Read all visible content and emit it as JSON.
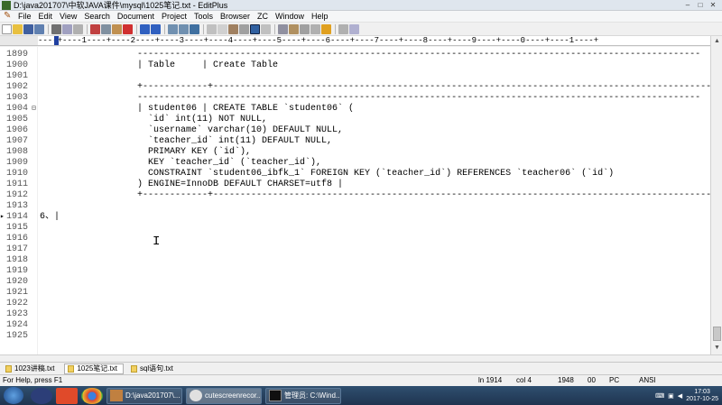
{
  "window": {
    "title": "D:\\java201707\\中软JAVA课件\\mysql\\1025笔记.txt - EditPlus",
    "controls": [
      "–",
      "□",
      "✕"
    ]
  },
  "menu": [
    "File",
    "Edit",
    "View",
    "Search",
    "Document",
    "Project",
    "Tools",
    "Browser",
    "ZC",
    "Window",
    "Help"
  ],
  "ruler": "----+----1----+----2----+----3----+----4----+----5----+----6----+----7----+----8----+----9----+----0----+----1----+",
  "editor": {
    "lines": [
      {
        "n": "1899",
        "text": "                  --------------------------------------------------------------------------------------------------------",
        "fold": ""
      },
      {
        "n": "1900",
        "text": "                  | Table     | Create Table",
        "fold": ""
      },
      {
        "n": "1901",
        "text": "",
        "fold": ""
      },
      {
        "n": "1902",
        "text": "                  +------------+---------------------------------------------------------------------------------------------",
        "fold": ""
      },
      {
        "n": "1903",
        "text": "                  --------------------------------------------------------------------------------------------------------",
        "fold": ""
      },
      {
        "n": "1904",
        "text": "                  | student06 | CREATE TABLE `student06` (",
        "fold": "⊟"
      },
      {
        "n": "1905",
        "text": "                    `id` int(11) NOT NULL,",
        "fold": ""
      },
      {
        "n": "1906",
        "text": "                    `username` varchar(10) DEFAULT NULL,",
        "fold": ""
      },
      {
        "n": "1907",
        "text": "                    `teacher_id` int(11) DEFAULT NULL,",
        "fold": ""
      },
      {
        "n": "1908",
        "text": "                    PRIMARY KEY (`id`),",
        "fold": ""
      },
      {
        "n": "1909",
        "text": "                    KEY `teacher_id` (`teacher_id`),",
        "fold": ""
      },
      {
        "n": "1910",
        "text": "                    CONSTRAINT `student06_ibfk_1` FOREIGN KEY (`teacher_id`) REFERENCES `teacher06` (`id`)",
        "fold": ""
      },
      {
        "n": "1911",
        "text": "                  ) ENGINE=InnoDB DEFAULT CHARSET=utf8 |",
        "fold": ""
      },
      {
        "n": "1912",
        "text": "                  +------------+---------------------------------------------------------------------------------------------",
        "fold": ""
      },
      {
        "n": "1913",
        "text": "",
        "fold": ""
      },
      {
        "n": "1914",
        "text": "6、|",
        "fold": ""
      },
      {
        "n": "1915",
        "text": "",
        "fold": ""
      },
      {
        "n": "1916",
        "text": "",
        "fold": ""
      },
      {
        "n": "1917",
        "text": "",
        "fold": ""
      },
      {
        "n": "1918",
        "text": "",
        "fold": ""
      },
      {
        "n": "1919",
        "text": "",
        "fold": ""
      },
      {
        "n": "1920",
        "text": "",
        "fold": ""
      },
      {
        "n": "1921",
        "text": "",
        "fold": ""
      },
      {
        "n": "1922",
        "text": "",
        "fold": ""
      },
      {
        "n": "1923",
        "text": "",
        "fold": ""
      },
      {
        "n": "1924",
        "text": "",
        "fold": ""
      },
      {
        "n": "1925",
        "text": "",
        "fold": ""
      }
    ],
    "current_line_marker": "▸"
  },
  "tabs": [
    "1023讲稿.txt",
    "1025笔记.txt",
    "sql语句.txt"
  ],
  "status": {
    "help": "For Help, press F1",
    "line": "ln 1914",
    "col": "col 4",
    "total": "1948",
    "num": "00",
    "mode": "PC",
    "encoding": "ANSI"
  },
  "taskbar": {
    "tasks": [
      "D:\\java201707\\...",
      "cutescreenrecor...",
      "管理员: C:\\Wind..."
    ],
    "clock_time": "17:03",
    "clock_date": "2017-10-25"
  },
  "colors": {
    "taskbar": "#1f3450",
    "ruler_caret": "#2040a0"
  }
}
